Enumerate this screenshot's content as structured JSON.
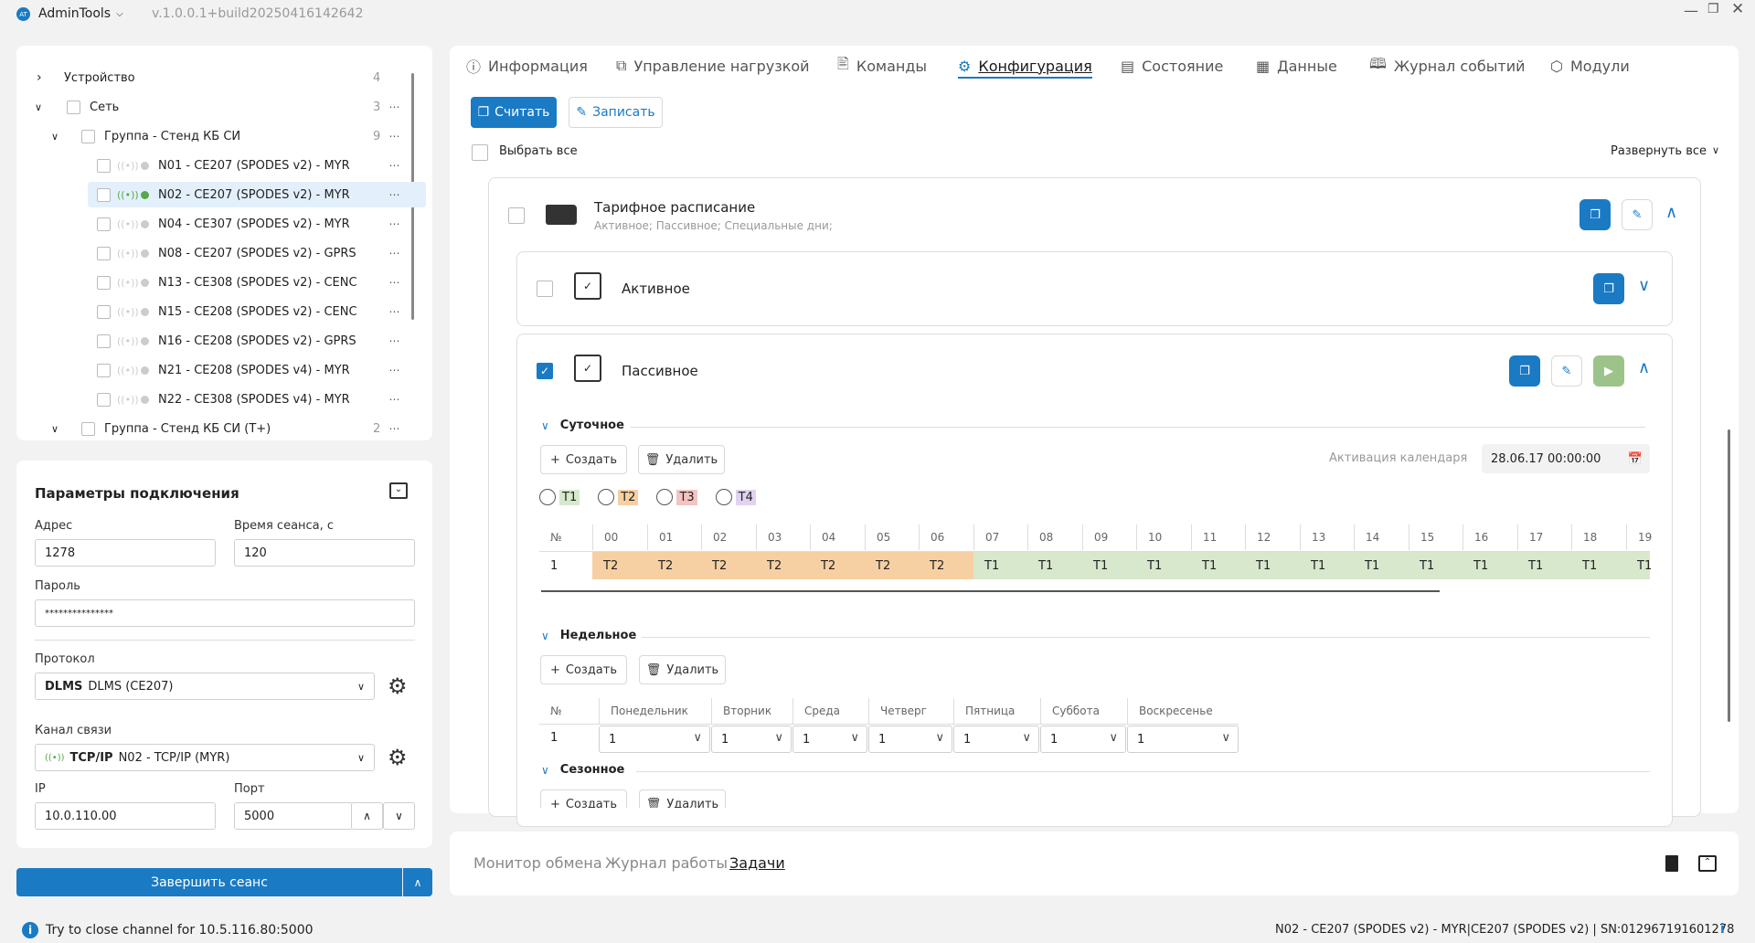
{
  "app": {
    "logo": "AT",
    "name": "AdminTools",
    "version": "v.1.0.0.1+build20250416142642"
  },
  "tree": [
    {
      "label": "Устройство",
      "count": "4"
    },
    {
      "label": "Сеть",
      "count": "3"
    },
    {
      "label": "Группа - Стенд КБ СИ",
      "count": "9"
    },
    {
      "label": "N01 - CE207 (SPODES v2) - MYR"
    },
    {
      "label": "N02 - CE207 (SPODES v2) - MYR"
    },
    {
      "label": "N04 - CE307 (SPODES v2) - MYR"
    },
    {
      "label": "N08 - CE207 (SPODES v2) - GPRS"
    },
    {
      "label": "N13 - CE308 (SPODES v2) - CENC"
    },
    {
      "label": "N15 - CE208 (SPODES v2) - CENC"
    },
    {
      "label": "N16 - CE208 (SPODES v2) - GPRS"
    },
    {
      "label": "N21 - CE208 (SPODES v4) - MYR"
    },
    {
      "label": "N22 - CE308 (SPODES v4) - MYR"
    },
    {
      "label": "Группа - Стенд КБ СИ (Т+)",
      "count": "2"
    }
  ],
  "conn": {
    "title": "Параметры подключения",
    "address_label": "Адрес",
    "address": "1278",
    "session_label": "Время сеанса, с",
    "session": "120",
    "password_label": "Пароль",
    "password": "***************",
    "protocol_label": "Протокол",
    "protocol_bold": "DLMS",
    "protocol": "DLMS (CE207)",
    "channel_label": "Канал связи",
    "channel_bold": "TCP/IP",
    "channel": "N02 - TCP/IP (MYR)",
    "ip_label": "IP",
    "ip": "10.0.110.00",
    "port_label": "Порт",
    "port": "5000",
    "end_button": "Завершить сеанс"
  },
  "tabs": [
    "Информация",
    "Управление нагрузкой",
    "Команды",
    "Конфигурация",
    "Состояние",
    "Данные",
    "Журнал событий",
    "Модули"
  ],
  "toolbar": {
    "read": "Считать",
    "write": "Записать",
    "select_all": "Выбрать все",
    "expand_all": "Развернуть все"
  },
  "tariff": {
    "title": "Тарифное расписание",
    "subtitle": "Активное; Пассивное; Специальные дни;",
    "active": "Активное",
    "passive": "Пассивное"
  },
  "daily": {
    "title": "Суточное",
    "create": "Создать",
    "delete": "Удалить",
    "activation_label": "Активация календаря",
    "activation_value": "28.06.17 00:00:00",
    "radios": [
      "T1",
      "T2",
      "T3",
      "T4"
    ],
    "radio_colors": [
      "#d7e8cc",
      "#f6d0a3",
      "#f4c3c3",
      "#e1d3ef"
    ],
    "num_header": "№",
    "hours": [
      "00",
      "01",
      "02",
      "03",
      "04",
      "05",
      "06",
      "07",
      "08",
      "09",
      "10",
      "11",
      "12",
      "13",
      "14",
      "15",
      "16",
      "17",
      "18",
      "19"
    ],
    "row_num": "1",
    "row": [
      "T2",
      "T2",
      "T2",
      "T2",
      "T2",
      "T2",
      "T2",
      "T1",
      "T1",
      "T1",
      "T1",
      "T1",
      "T1",
      "T1",
      "T1",
      "T1",
      "T1",
      "T1",
      "T1",
      "T1"
    ]
  },
  "weekly": {
    "title": "Недельное",
    "create": "Создать",
    "delete": "Удалить",
    "num_header": "№",
    "days": [
      "Понедельник",
      "Вторник",
      "Среда",
      "Четверг",
      "Пятница",
      "Суббота",
      "Воскресенье"
    ],
    "row_num": "1",
    "values": [
      "1",
      "1",
      "1",
      "1",
      "1",
      "1",
      "1"
    ]
  },
  "seasonal": {
    "title": "Сезонное",
    "create": "Создать",
    "delete": "Удалить"
  },
  "bottom_tabs": [
    "Монитор обмена",
    "Журнал работы",
    "Задачи"
  ],
  "status": {
    "message": "Try to close channel for 10.5.116.80:5000",
    "device": "N02 - CE207 (SPODES v2) - MYR|CE207 (SPODES v2) | SN:012967191601278"
  }
}
